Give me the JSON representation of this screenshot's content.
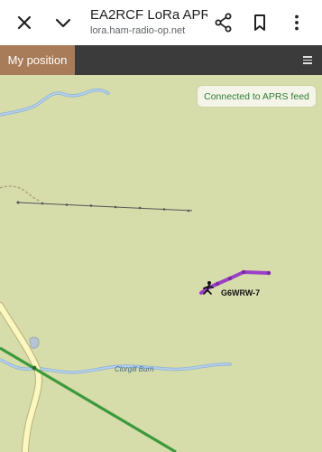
{
  "browser": {
    "title": "EA2RCF LoRa APR…",
    "url": "lora.ham-radio-op.net",
    "icons": [
      "close-icon",
      "chevron-down-icon",
      "share-icon",
      "bookmark-icon",
      "more-vert-icon"
    ]
  },
  "nav": {
    "active_tab": "My position",
    "menu_icon": "hamburger-icon",
    "tab_color": "#a97c59",
    "bar_color": "#3b3b3b"
  },
  "map": {
    "feed_status": "Connected to APRS feed",
    "station_callsign": "G6WRW-7",
    "waterway_label": "Clorgill Burn",
    "colors": {
      "land": "#d7dcab",
      "water": "#a8c6e3",
      "road": "#fbf7c0",
      "track": "#9b3fc9",
      "rail": "#3c9a3c"
    }
  }
}
